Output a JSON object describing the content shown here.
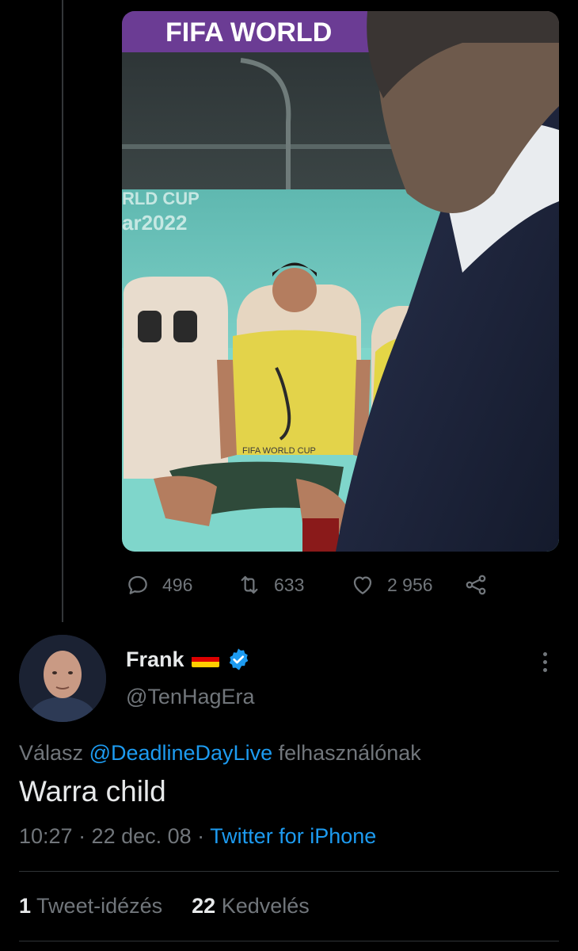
{
  "previous_tweet": {
    "media": {
      "banner_text": "FIFA WORLD",
      "wall_text_line1": "RLD CUP",
      "wall_text_line2": "ar2022",
      "bib_text": "FIFA WORLD CUP"
    },
    "actions": {
      "replies": "496",
      "retweets": "633",
      "likes": "2 956"
    }
  },
  "tweet": {
    "display_name": "Frank",
    "handle": "@TenHagEra",
    "reply_prefix": "Válasz",
    "reply_mention": "@DeadlineDayLive",
    "reply_suffix": "felhasználónak",
    "text": "Warra child",
    "time_date": "10:27 · 22 dec. 08 · ",
    "source": "Twitter for iPhone",
    "quote_count": "1",
    "quote_label": "Tweet-idézés",
    "like_count": "22",
    "like_label": "Kedvelés"
  },
  "colors": {
    "background": "#000000",
    "text_primary": "#e7e9ea",
    "text_secondary": "#71767b",
    "accent": "#1d9bf0",
    "divider": "#2f3336"
  },
  "icons": [
    "reply-icon",
    "retweet-icon",
    "like-icon",
    "share-icon",
    "verified-badge-icon",
    "germany-flag-icon",
    "more-icon"
  ]
}
